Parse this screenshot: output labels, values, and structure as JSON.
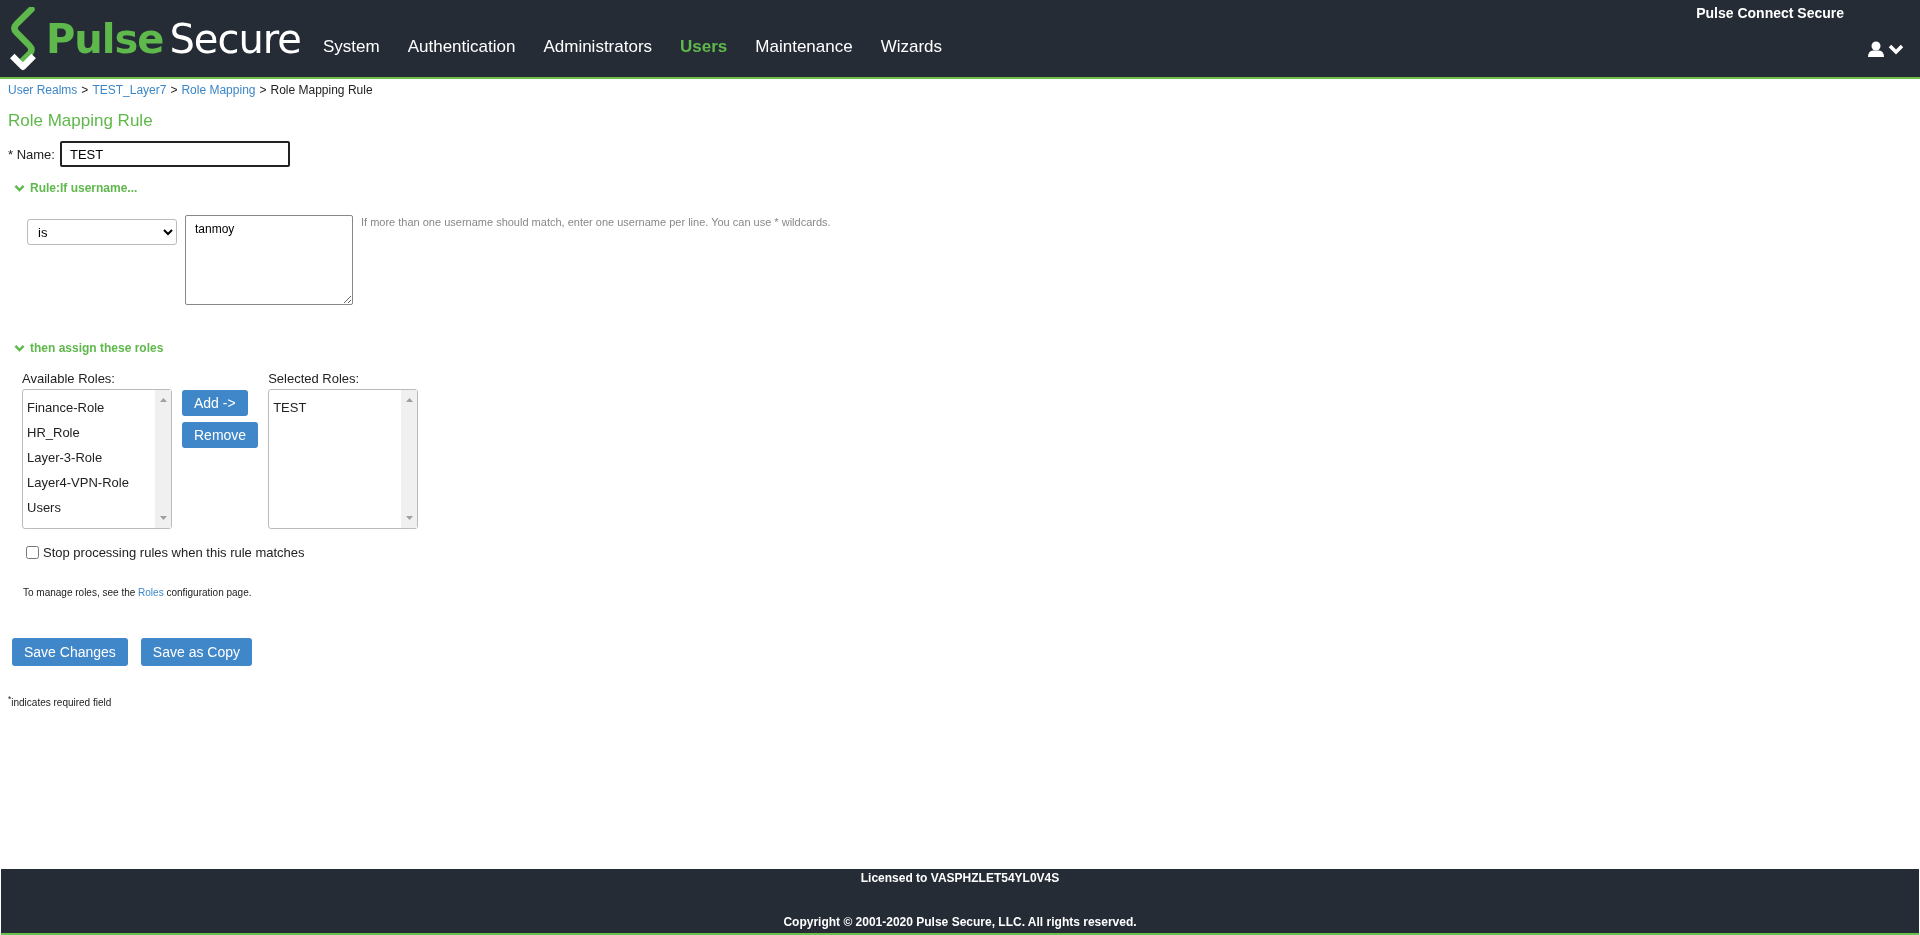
{
  "header": {
    "logo": {
      "word_1": "Pulse",
      "word_2": "Secure"
    },
    "product": "Pulse Connect Secure",
    "nav": [
      {
        "label": "System",
        "selected": false
      },
      {
        "label": "Authentication",
        "selected": false
      },
      {
        "label": "Administrators",
        "selected": false
      },
      {
        "label": "Users",
        "selected": true
      },
      {
        "label": "Maintenance",
        "selected": false
      },
      {
        "label": "Wizards",
        "selected": false
      }
    ]
  },
  "breadcrumb": [
    {
      "label": "User Realms",
      "link": true,
      "separator": ">"
    },
    {
      "label": "TEST_Layer7",
      "link": true,
      "separator": ">"
    },
    {
      "label": "Role Mapping",
      "link": true,
      "separator": ">"
    },
    {
      "label": "Role Mapping Rule",
      "link": false
    }
  ],
  "page_title": "Role Mapping Rule",
  "name_field": {
    "label": "* Name:",
    "value": "TEST"
  },
  "rule_section": {
    "title": "Rule:If username...",
    "expanded": true,
    "operator": "is",
    "usernames": "tanmoy",
    "hint": "If more than one username should match, enter one username per line. You can use * wildcards."
  },
  "roles_section": {
    "title": "then assign these roles",
    "expanded": true,
    "available_label": "Available Roles:",
    "available": [
      "Finance-Role",
      "HR_Role",
      "Layer-3-Role",
      "Layer4-VPN-Role",
      "Users"
    ],
    "move_buttons": [
      "Add ->",
      "Remove"
    ],
    "selected_label": "Selected Roles:",
    "selected": [
      "TEST"
    ]
  },
  "stop_processing": {
    "label": "Stop processing rules when this rule matches",
    "checked": false
  },
  "manage_note": {
    "before": "To manage roles, see the ",
    "link": "Roles",
    "after": " configuration page."
  },
  "buttons": [
    "Save Changes",
    "Save as Copy"
  ],
  "required_note": "$^{*}$indicates required field",
  "footer": {
    "license": "Licensed to VASPHZLET54YL0V4S",
    "copyright": "Copyright © 2001-2020 Pulse Secure, LLC. All rights reserved."
  }
}
